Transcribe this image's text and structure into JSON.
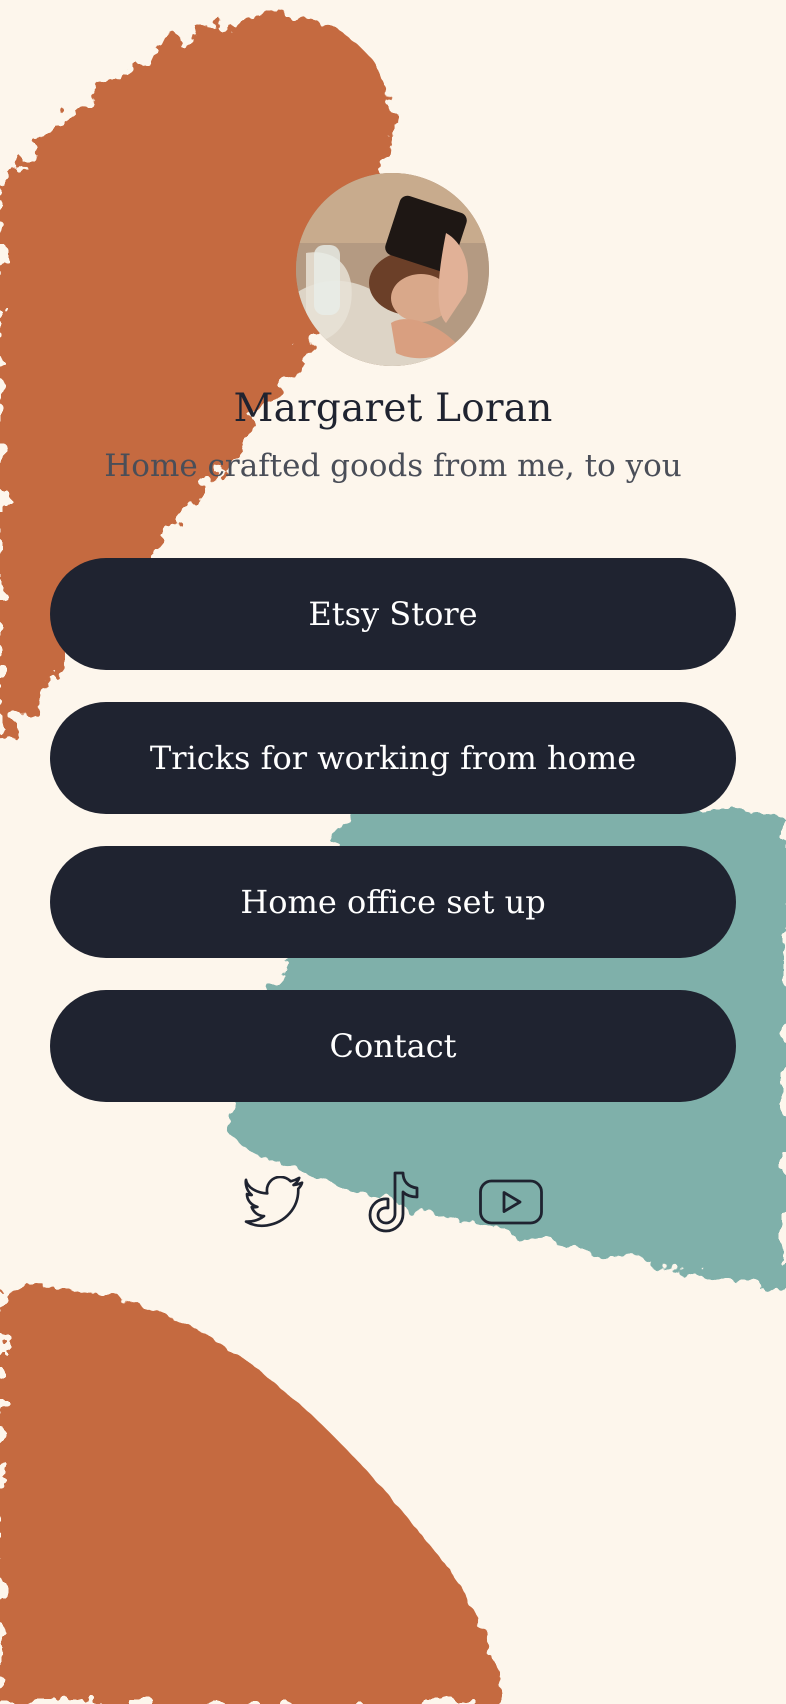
{
  "profile": {
    "name": "Margaret Loran",
    "bio": "Home crafted goods from me, to you"
  },
  "links": [
    {
      "label": "Etsy Store"
    },
    {
      "label": "Tricks for working from home"
    },
    {
      "label": "Home office set up"
    },
    {
      "label": "Contact"
    }
  ],
  "socials": [
    {
      "icon": "twitter-icon"
    },
    {
      "icon": "tiktok-icon"
    },
    {
      "icon": "youtube-icon"
    }
  ],
  "colors": {
    "background": "#fdf6ec",
    "button": "#1f2330",
    "button_text": "#ffffff",
    "terracotta": "#c56a3f",
    "teal": "#7fb0aa"
  }
}
